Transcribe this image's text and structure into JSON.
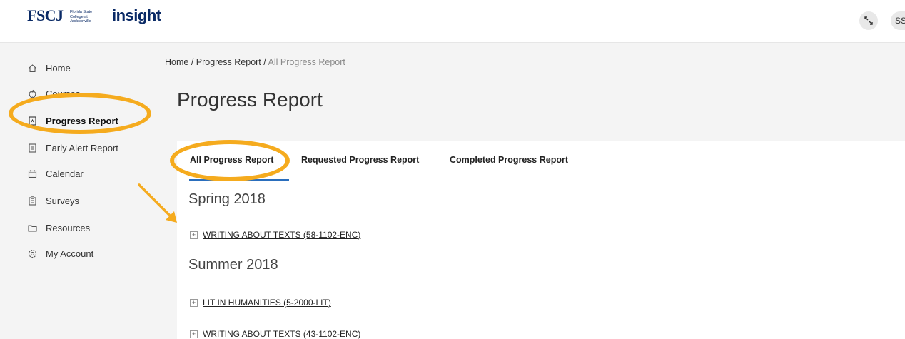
{
  "header": {
    "logo_fscj": "FSCJ",
    "logo_fscj_sub": "Florida State College at Jacksonville",
    "logo_insight": "insight",
    "icon_button": "expand-icon",
    "avatar": "SS"
  },
  "sidebar": {
    "items": [
      {
        "label": "Home",
        "icon": "home-icon"
      },
      {
        "label": "Courses",
        "icon": "apple-icon"
      },
      {
        "label": "Progress Report",
        "icon": "report-icon"
      },
      {
        "label": "Early Alert Report",
        "icon": "document-icon"
      },
      {
        "label": "Calendar",
        "icon": "calendar-icon"
      },
      {
        "label": "Surveys",
        "icon": "clipboard-icon"
      },
      {
        "label": "Resources",
        "icon": "folder-icon"
      },
      {
        "label": "My Account",
        "icon": "gear-icon"
      }
    ]
  },
  "breadcrumb": {
    "home": "Home",
    "sep": " / ",
    "parent": "Progress Report",
    "current": "All Progress Report"
  },
  "page_title": "Progress Report",
  "tabs": [
    {
      "label": "All Progress Report",
      "active": true
    },
    {
      "label": "Requested Progress Report",
      "active": false
    },
    {
      "label": "Completed Progress Report",
      "active": false
    }
  ],
  "terms": [
    {
      "name": "Spring 2018",
      "courses": [
        "WRITING ABOUT TEXTS (58-1102-ENC)"
      ]
    },
    {
      "name": "Summer 2018",
      "courses": [
        "LIT IN HUMANITIES (5-2000-LIT)",
        "WRITING ABOUT TEXTS (43-1102-ENC)"
      ]
    }
  ],
  "colors": {
    "highlight": "#f5ab1e",
    "active_tab": "#2a6ebd",
    "brand": "#0a2a66"
  }
}
